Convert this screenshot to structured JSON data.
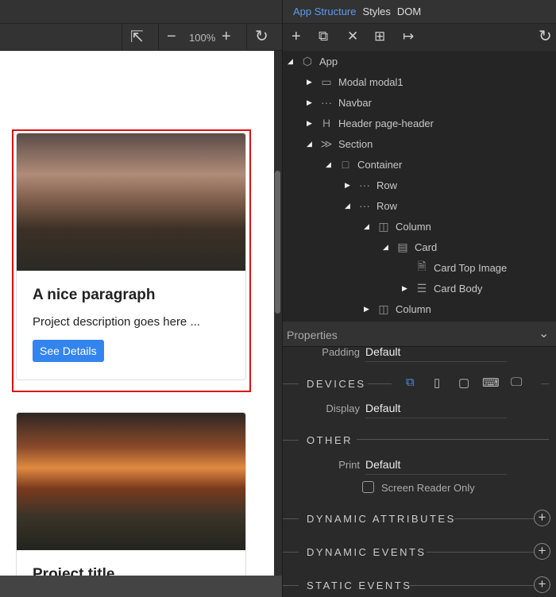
{
  "tabs": [
    "App Structure",
    "Styles",
    "DOM"
  ],
  "toolbar": {
    "zoom": "100%"
  },
  "cards": [
    {
      "title": "A nice paragraph",
      "text": "Project description goes here ...",
      "button": "See Details"
    },
    {
      "title": "Project title"
    }
  ],
  "tree": [
    {
      "label": "App",
      "icon": "cube-icon",
      "depth": 0,
      "twisty": "open"
    },
    {
      "label": "Modal modal1",
      "icon": "window-icon",
      "depth": 1,
      "twisty": "closed"
    },
    {
      "label": "Navbar",
      "icon": "dots-icon",
      "depth": 1,
      "twisty": "closed"
    },
    {
      "label": "Header page-header",
      "icon": "heading-icon",
      "depth": 1,
      "twisty": "closed"
    },
    {
      "label": "Section",
      "icon": "chevrons-icon",
      "depth": 1,
      "twisty": "open"
    },
    {
      "label": "Container",
      "icon": "square-icon",
      "depth": 2,
      "twisty": "open"
    },
    {
      "label": "Row",
      "icon": "dots-icon",
      "depth": 3,
      "twisty": "closed"
    },
    {
      "label": "Row",
      "icon": "dots-icon",
      "depth": 3,
      "twisty": "open"
    },
    {
      "label": "Column",
      "icon": "column-icon",
      "depth": 4,
      "twisty": "open"
    },
    {
      "label": "Card",
      "icon": "card-icon",
      "depth": 5,
      "twisty": "open"
    },
    {
      "label": "Card Top Image",
      "icon": "image-icon",
      "depth": 6,
      "twisty": ""
    },
    {
      "label": "Card Body",
      "icon": "lines-icon",
      "depth": 6,
      "twisty": "closed"
    },
    {
      "label": "Column",
      "icon": "column-icon",
      "depth": 4,
      "twisty": "closed"
    }
  ],
  "properties": {
    "title": "Properties",
    "padding_label": "Padding",
    "padding_value": "Default",
    "devices": "DEVICES",
    "display_label": "Display",
    "display_value": "Default",
    "other": "OTHER",
    "print_label": "Print",
    "print_value": "Default",
    "screen_reader": "Screen Reader Only",
    "dynamic_attributes": "DYNAMIC ATTRIBUTES",
    "dynamic_events": "DYNAMIC EVENTS",
    "static_events": "STATIC EVENTS"
  }
}
